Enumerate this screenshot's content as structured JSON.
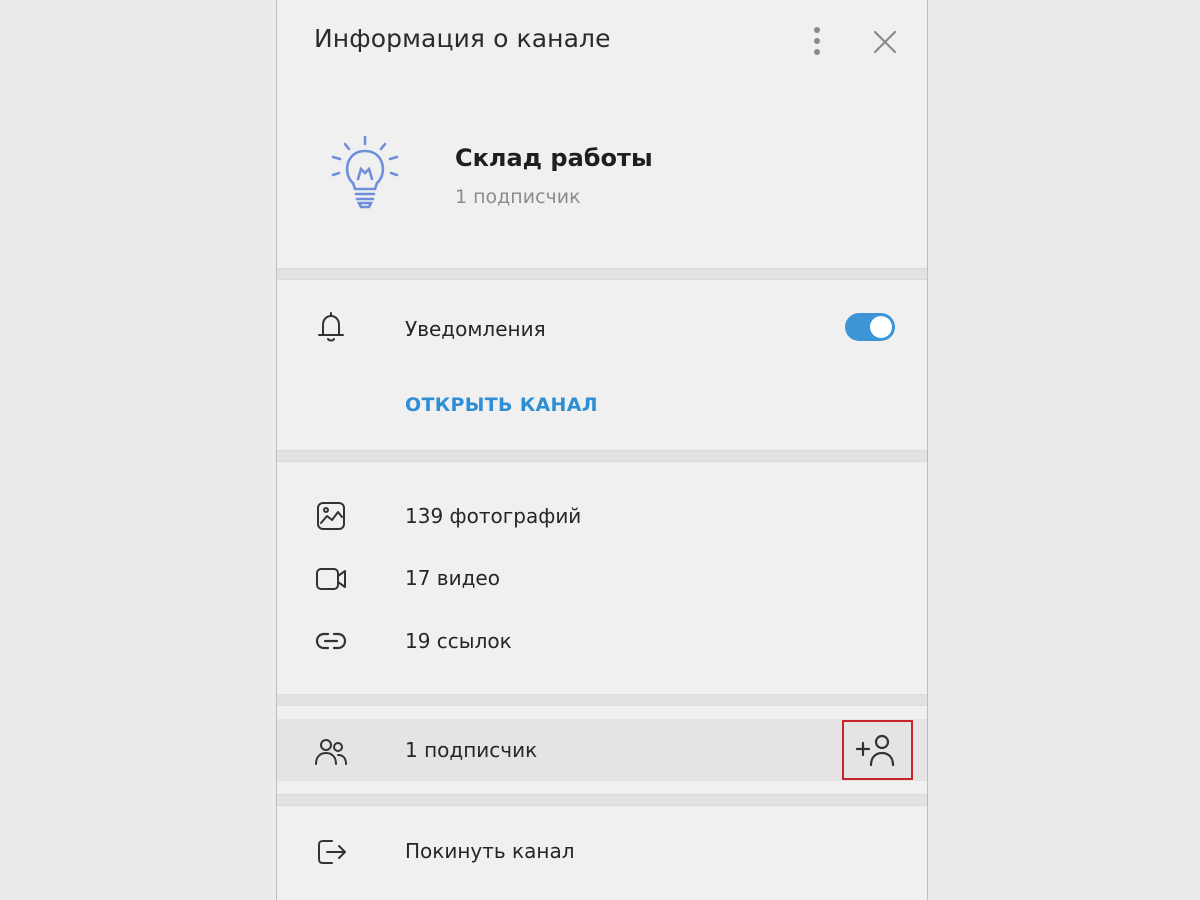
{
  "header": {
    "title": "Информация о канале",
    "menu_icon": "more-vertical-icon",
    "close_icon": "close-icon"
  },
  "profile": {
    "name": "Склад работы",
    "subscribers": "1 подписчик",
    "avatar_icon": "lightbulb-icon",
    "avatar_color": "#6f8fdc"
  },
  "settings": {
    "notifications_label": "Уведомления",
    "notifications_enabled": true,
    "open_channel_label": "ОТКРЫТЬ КАНАЛ",
    "accent_color": "#2f8fd4"
  },
  "media": [
    {
      "icon": "photo-icon",
      "label": "139 фотографий"
    },
    {
      "icon": "video-icon",
      "label": "17 видео"
    },
    {
      "icon": "link-icon",
      "label": "19 ссылок"
    }
  ],
  "members": {
    "label": "1 подписчик",
    "icon": "users-icon",
    "add_icon": "add-user-icon"
  },
  "leave": {
    "label": "Покинуть канал",
    "icon": "logout-icon"
  }
}
